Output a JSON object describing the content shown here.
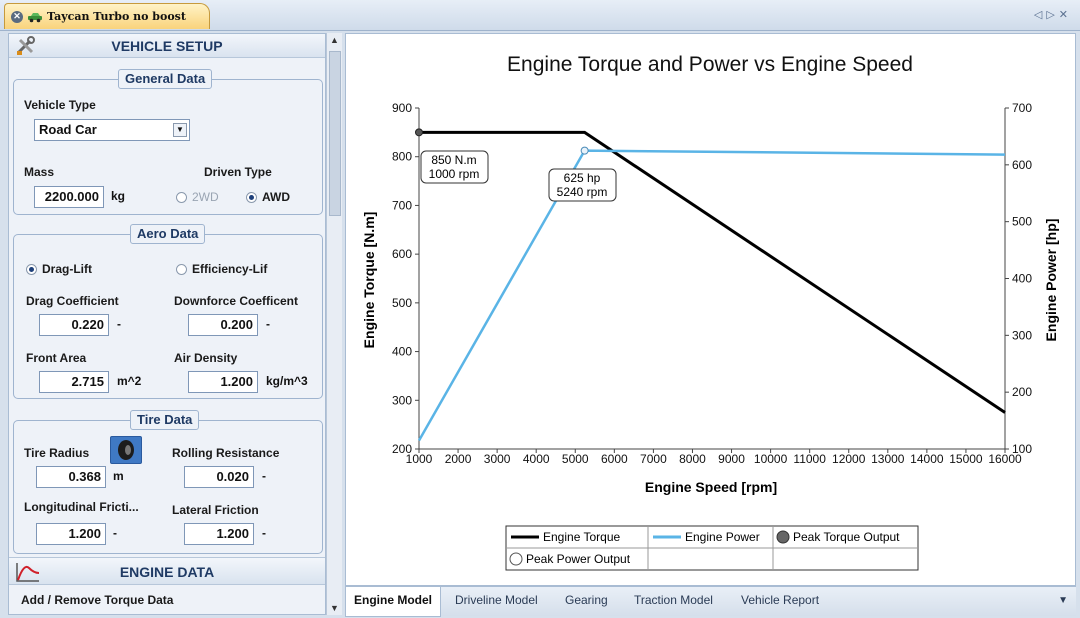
{
  "document_tab": {
    "title": "Taycan Turbo no boost"
  },
  "vehicle_setup": {
    "header": "VEHICLE SETUP",
    "general": {
      "title": "General Data",
      "vehicle_type_label": "Vehicle Type",
      "vehicle_type_value": "Road Car",
      "mass_label": "Mass",
      "mass_value": "2200.000",
      "mass_unit": "kg",
      "driven_type_label": "Driven Type",
      "opt_2wd": "2WD",
      "opt_awd": "AWD"
    },
    "aero": {
      "title": "Aero Data",
      "opt_drag_lift": "Drag-Lift",
      "opt_efficiency": "Efficiency-Lif",
      "drag_coef_label": "Drag Coefficient",
      "drag_coef_value": "0.220",
      "drag_coef_unit": "-",
      "downforce_label": "Downforce Coefficent",
      "downforce_value": "0.200",
      "downforce_unit": "-",
      "front_area_label": "Front Area",
      "front_area_value": "2.715",
      "front_area_unit": "m^2",
      "air_density_label": "Air Density",
      "air_density_value": "1.200",
      "air_density_unit": "kg/m^3"
    },
    "tire": {
      "title": "Tire Data",
      "radius_label": "Tire Radius",
      "radius_value": "0.368",
      "radius_unit": "m",
      "rolling_label": "Rolling Resistance",
      "rolling_value": "0.020",
      "rolling_unit": "-",
      "long_fric_label": "Longitudinal Fricti...",
      "long_fric_value": "1.200",
      "long_fric_unit": "-",
      "lat_fric_label": "Lateral Friction",
      "lat_fric_value": "1.200",
      "lat_fric_unit": "-"
    }
  },
  "engine_data": {
    "header": "ENGINE DATA",
    "add_remove": "Add / Remove Torque Data"
  },
  "bottom_tabs": [
    "Engine Model",
    "Driveline Model",
    "Gearing",
    "Traction Model",
    "Vehicle Report"
  ],
  "chart_data": {
    "type": "line",
    "title": "Engine Torque and Power vs Engine Speed",
    "xlabel": "Engine Speed [rpm]",
    "ylabel": "Engine Torque [N.m]",
    "y2label": "Engine Power [hp]",
    "xlim": [
      1000,
      16000
    ],
    "ylim": [
      200,
      900
    ],
    "y2lim": [
      100,
      700
    ],
    "x_ticks": [
      1000,
      2000,
      3000,
      4000,
      5000,
      6000,
      7000,
      8000,
      9000,
      10000,
      11000,
      12000,
      13000,
      14000,
      15000,
      16000
    ],
    "y_ticks": [
      200,
      300,
      400,
      500,
      600,
      700,
      800,
      900
    ],
    "y2_ticks": [
      100,
      200,
      300,
      400,
      500,
      600,
      700
    ],
    "series": [
      {
        "name": "Engine Torque",
        "axis": "left",
        "color": "#000000",
        "x": [
          1000,
          5240,
          16000
        ],
        "y": [
          850,
          850,
          275
        ]
      },
      {
        "name": "Engine Power",
        "axis": "right",
        "color": "#5ab4e6",
        "x": [
          1000,
          5240,
          16000
        ],
        "y": [
          115,
          625,
          618
        ]
      }
    ],
    "peaks": [
      {
        "name": "Peak Torque Output",
        "axis": "left",
        "x": 1000,
        "y": 850,
        "label_lines": [
          "850 N.m",
          "1000 rpm"
        ]
      },
      {
        "name": "Peak Power Output",
        "axis": "right",
        "x": 5240,
        "y": 625,
        "label_lines": [
          "625 hp",
          "5240 rpm"
        ]
      }
    ],
    "legend": [
      "Engine Torque",
      "Engine Power",
      "Peak Torque Output",
      "Peak Power Output"
    ],
    "legend_position": "bottom",
    "grid": false
  }
}
